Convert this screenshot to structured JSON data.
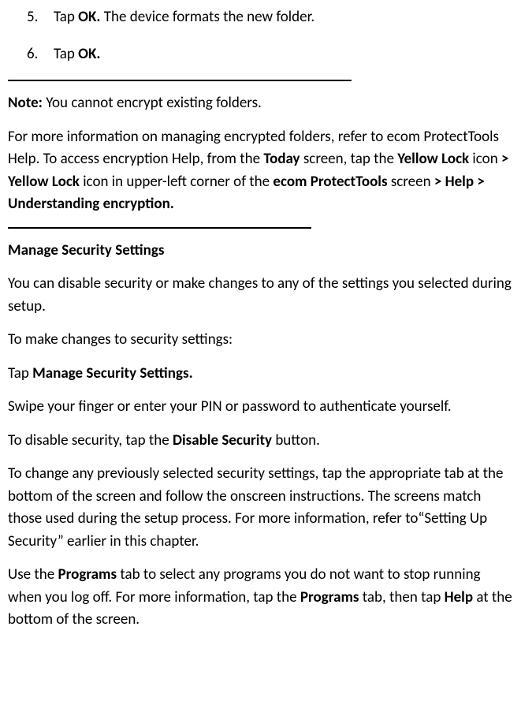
{
  "steps": [
    {
      "number": "5.",
      "prefix": "Tap ",
      "bold": "OK.",
      "suffix": " The device formats the new folder."
    },
    {
      "number": "6.",
      "prefix": "Tap ",
      "bold": "OK.",
      "suffix": ""
    }
  ],
  "note": {
    "label": "Note:",
    "text": " You cannot encrypt existing folders."
  },
  "info_para": {
    "t1": "For more information on managing encrypted folders, refer to ecom ProtectTools Help. To access encryption Help, from the ",
    "b1": "Today",
    "t2": " screen, tap the ",
    "b2": "Yellow Lock",
    "t3": " icon ",
    "b3": "> Yellow Lock",
    "t4": " icon in upper-left corner of the ",
    "b4": "ecom ProtectTools",
    "t5": " screen ",
    "b5": "> Help > Understanding encryption."
  },
  "section_heading": "Manage Security Settings",
  "para1": "You can disable security or make changes to any of the settings you selected during setup.",
  "para2": "To make changes to security settings:",
  "para3": {
    "t1": "Tap ",
    "b1": "Manage Security Settings."
  },
  "para4": "Swipe your finger or enter your PIN or password to authenticate yourself.",
  "para5": {
    "t1": "To disable security, tap the ",
    "b1": "Disable Security",
    "t2": " button."
  },
  "para6": "To change any previously selected security settings, tap the appropriate tab at the bottom of the screen and follow the onscreen instructions. The screens match those used during the setup process. For more information, refer to“Setting Up Security” earlier in this chapter.",
  "para7": {
    "t1": "Use the ",
    "b1": "Programs",
    "t2": " tab to select any programs you do not want to stop running when you log off. For more information, tap the ",
    "b2": "Programs",
    "t3": " tab, then tap ",
    "b3": "Help",
    "t4": " at the bottom of the screen."
  }
}
